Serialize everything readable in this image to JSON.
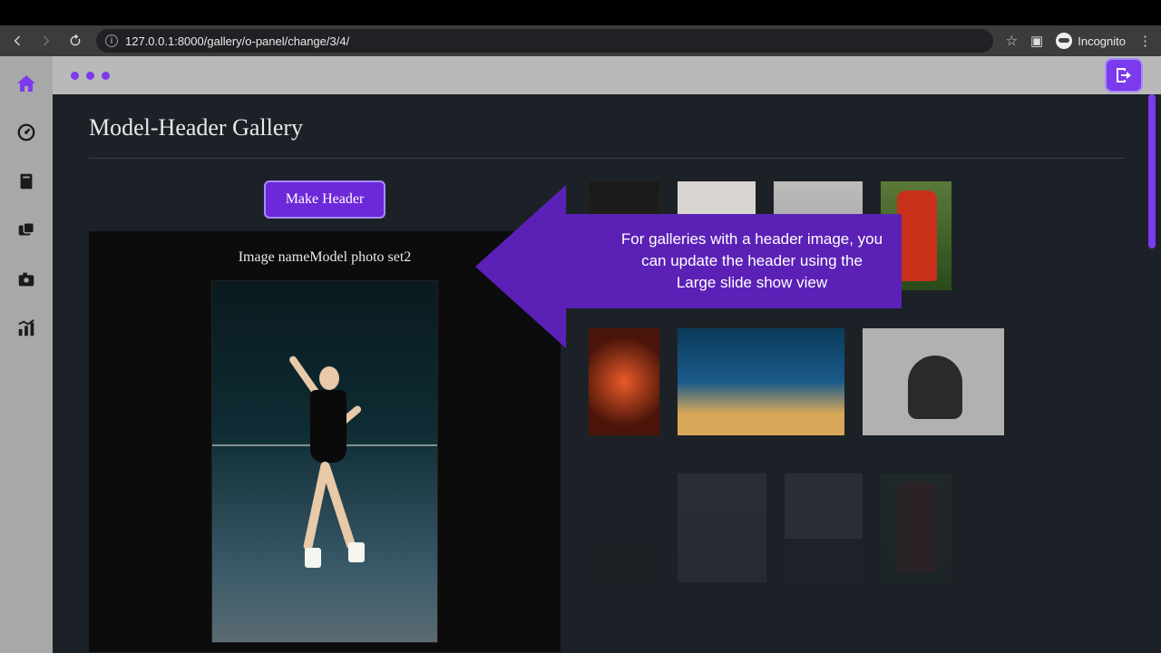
{
  "browser": {
    "url": "127.0.0.1:8000/gallery/o-panel/change/3/4/",
    "incognito_label": "Incognito"
  },
  "page": {
    "title": "Model-Header Gallery"
  },
  "slide": {
    "button_label": "Make Header",
    "caption_prefix": "Image name",
    "caption_value": "Model photo set2"
  },
  "callout": {
    "text": "For galleries with a header image, you can update the header using the Large slide show view"
  },
  "sidebar": {
    "items": [
      "home",
      "dashboard",
      "book",
      "gallery",
      "camera",
      "chart"
    ]
  }
}
